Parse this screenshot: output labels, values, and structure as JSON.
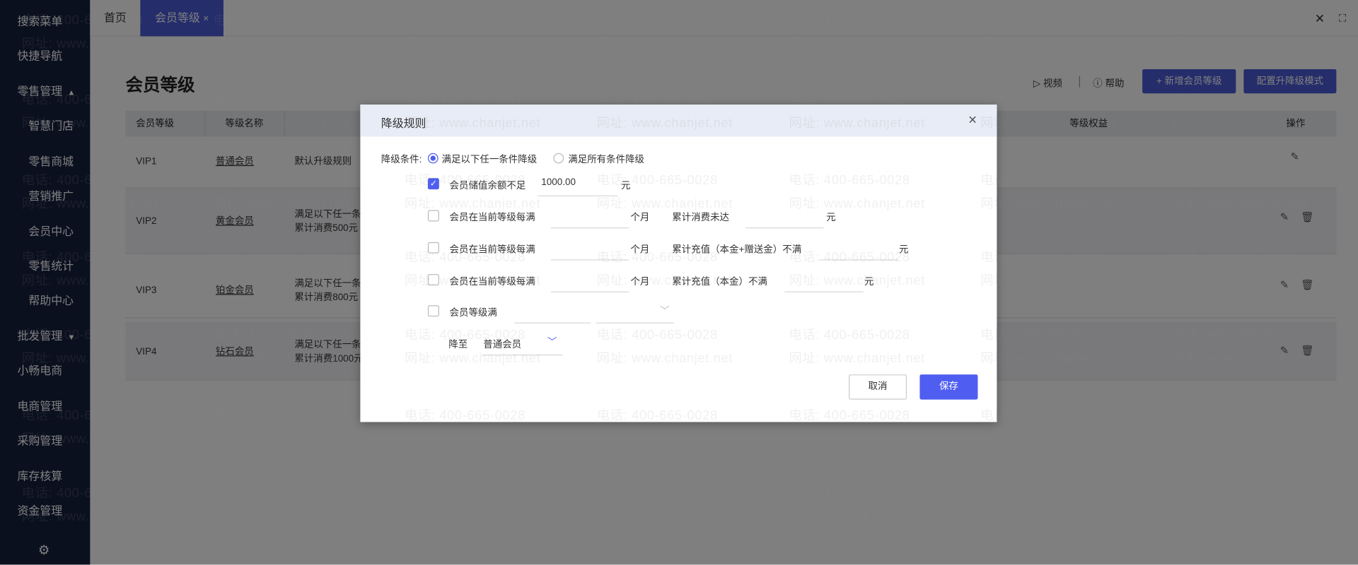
{
  "sidebar": {
    "items": [
      {
        "label": "搜索菜单"
      },
      {
        "label": "快捷导航"
      },
      {
        "label": "零售管理",
        "caret": "▲"
      },
      {
        "label": "智慧门店"
      },
      {
        "label": "零售商城"
      },
      {
        "label": "营销推广"
      },
      {
        "label": "会员中心"
      },
      {
        "label": "零售统计"
      },
      {
        "label": "帮助中心"
      },
      {
        "label": "批发管理",
        "caret": "▼"
      },
      {
        "label": "小畅电商"
      },
      {
        "label": "电商管理"
      },
      {
        "label": "采购管理"
      },
      {
        "label": "库存核算"
      },
      {
        "label": "资金管理"
      }
    ],
    "settings_icon": "⚙"
  },
  "tabs": {
    "home": "首页",
    "active": "会员等级",
    "close": "×",
    "close_all": "✕",
    "fullscreen": "⛶"
  },
  "page": {
    "title": "会员等级",
    "video": "视频",
    "help": "帮助",
    "add_button": "+ 新增会员等级",
    "config_button": "配置升降级模式"
  },
  "table": {
    "headers": {
      "level": "会员等级",
      "name": "等级名称",
      "benefits": "等级权益",
      "actions": "操作"
    },
    "rows": [
      {
        "level": "VIP1",
        "name": "普通会员",
        "rule1": "默认升级规则",
        "rule2": ""
      },
      {
        "level": "VIP2",
        "name": "黄金会员",
        "rule1": "满足以下任一条",
        "rule2": "累计消费500元"
      },
      {
        "level": "VIP3",
        "name": "铂金会员",
        "rule1": "满足以下任一条",
        "rule2": "累计消费800元"
      },
      {
        "level": "VIP4",
        "name": "钻石会员",
        "rule1": "满足以下任一条",
        "rule2": "累计消费1000元"
      }
    ]
  },
  "modal": {
    "title": "降级规则",
    "close": "×",
    "condition_label": "降级条件:",
    "radio_any": "满足以下任一条件降级",
    "radio_all": "满足所有条件降级",
    "row1": {
      "label": "会员储值余额不足",
      "value": "1000.00",
      "unit": "元"
    },
    "row2": {
      "label": "会员在当前等级每满",
      "months_unit": "个月",
      "cond": "累计消费未达",
      "unit": "元"
    },
    "row3": {
      "label": "会员在当前等级每满",
      "months_unit": "个月",
      "cond": "累计充值（本金+赠送金）不满",
      "unit": "元"
    },
    "row4": {
      "label": "会员在当前等级每满",
      "months_unit": "个月",
      "cond": "累计充值（本金）不满",
      "unit": "元"
    },
    "row5": {
      "label": "会员等级满"
    },
    "row6": {
      "label": "降至",
      "value": "普通会员"
    },
    "cancel": "取消",
    "save": "保存"
  },
  "watermark": {
    "phone": "电话: 400-665-0028",
    "url": "网址: www.chanjet.net"
  },
  "colors": {
    "accent": "#4f5ef0",
    "sidebar": "#16203f",
    "modal_header": "#e8ecf6"
  }
}
